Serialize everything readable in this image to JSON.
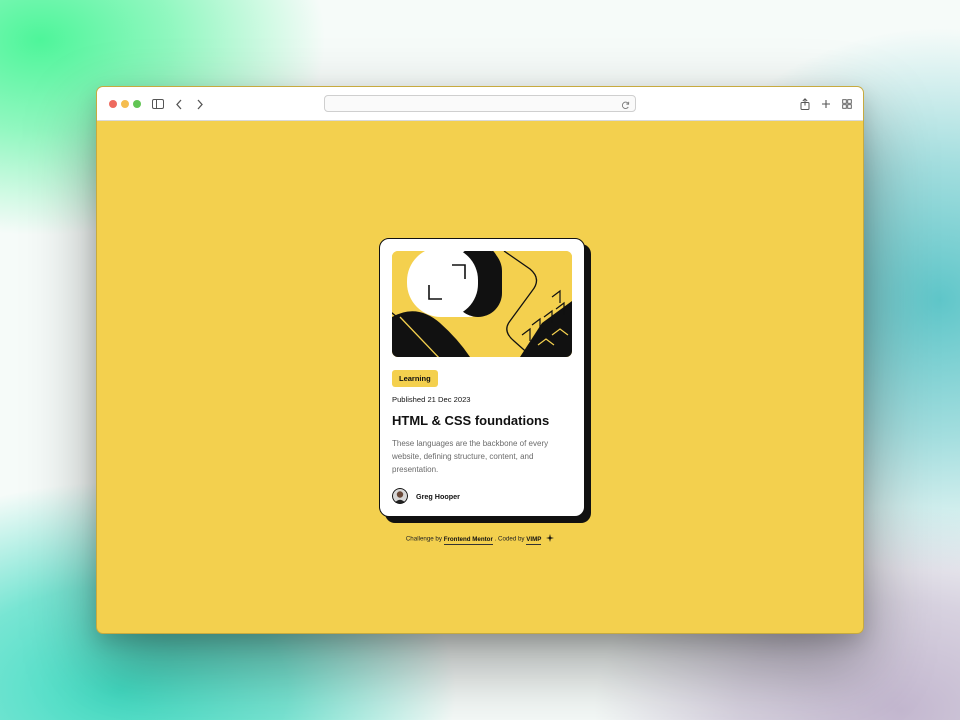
{
  "browser": {
    "address_value": "",
    "icons": [
      "sidebar-icon",
      "back-icon",
      "forward-icon",
      "reload-icon",
      "share-icon",
      "new-tab-icon",
      "tab-overview-icon"
    ]
  },
  "card": {
    "category": "Learning",
    "published": "Published 21 Dec 2023",
    "title": "HTML & CSS foundations",
    "description": "These languages are the backbone of every website, defining structure, content, and presentation.",
    "author": "Greg Hooper"
  },
  "attribution": {
    "challenge_text": "Challenge by",
    "challenge_link": "Frontend Mentor",
    "coded_text": ". Coded by",
    "coder_link": "VIMP"
  },
  "colors": {
    "page_background": "#f3d04e",
    "card_background": "#ffffff",
    "ink": "#111111",
    "muted_text": "#6b6b6b"
  }
}
